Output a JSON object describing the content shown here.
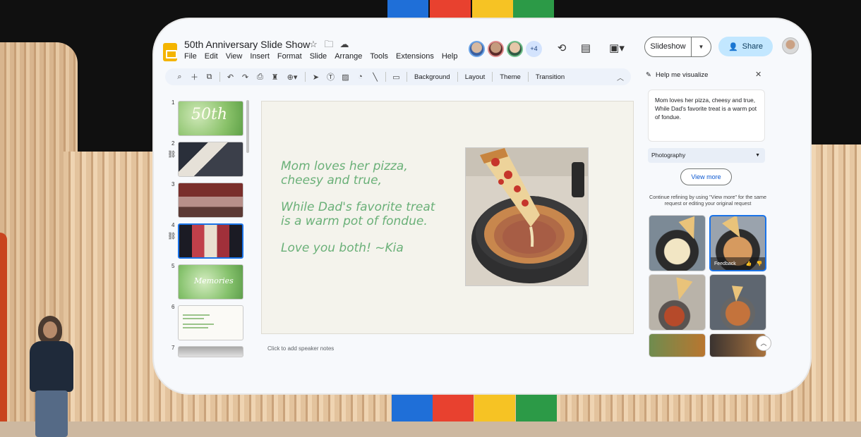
{
  "document": {
    "title": "50th Anniversary Slide Show"
  },
  "menu": [
    "File",
    "Edit",
    "View",
    "Insert",
    "Format",
    "Slide",
    "Arrange",
    "Tools",
    "Extensions",
    "Help"
  ],
  "collaborators": {
    "more_count": "+4"
  },
  "header": {
    "slideshow_label": "Slideshow",
    "share_label": "Share"
  },
  "toolbar": {
    "background": "Background",
    "layout": "Layout",
    "theme": "Theme",
    "transition": "Transition"
  },
  "filmstrip": {
    "slides": [
      {
        "number": "1",
        "title": "50th"
      },
      {
        "number": "2"
      },
      {
        "number": "3"
      },
      {
        "number": "4"
      },
      {
        "number": "5",
        "title": "Memories"
      },
      {
        "number": "6"
      },
      {
        "number": "7"
      }
    ]
  },
  "slide": {
    "lines": [
      "Mom loves her pizza,\ncheesy and true,",
      "While Dad's favorite treat\nis a warm pot of fondue.",
      "Love you both! ~Kia"
    ]
  },
  "speaker_notes": {
    "placeholder": "Click to add speaker notes"
  },
  "visualize_panel": {
    "title": "Help me visualize",
    "prompt": "Mom loves her pizza, cheesy and true, While Dad's favorite treat is a warm pot of fondue.",
    "style": "Photography",
    "view_more": "View more",
    "hint": "Continue refining by using \"View more\" for the same request or editing your original request",
    "feedback_label": "Feedback"
  },
  "colors": {
    "accent": "#1a73e8",
    "slide_text": "#6ab078",
    "share_bg": "#c2e7ff"
  }
}
